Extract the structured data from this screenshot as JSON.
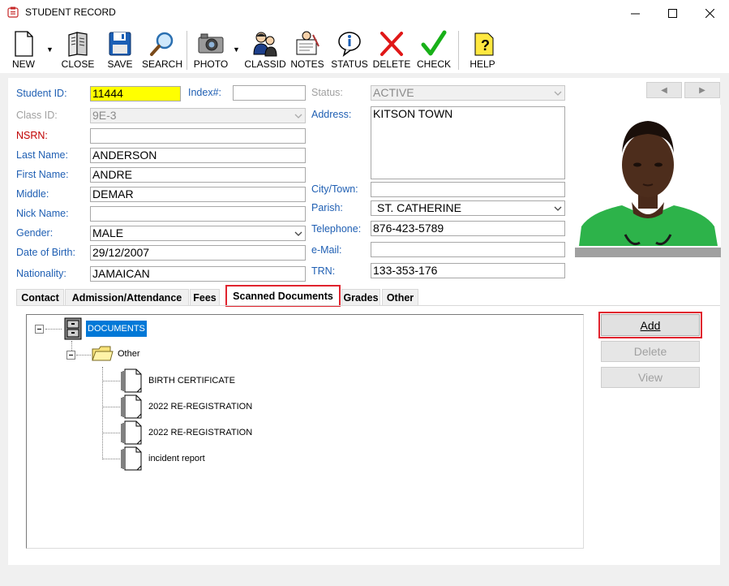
{
  "window": {
    "title": "STUDENT RECORD",
    "minimize": "—",
    "maximize": "☐",
    "close": "✕"
  },
  "toolbar": {
    "new": "NEW",
    "close": "CLOSE",
    "save": "SAVE",
    "search": "SEARCH",
    "photo": "PHOTO",
    "classid": "CLASSID",
    "notes": "NOTES",
    "status": "STATUS",
    "delete": "DELETE",
    "check": "CHECK",
    "help": "HELP"
  },
  "form": {
    "student_id_label": "Student ID:",
    "student_id": "11444",
    "index_label": "Index#:",
    "index_value": "",
    "class_id_label": "Class ID:",
    "class_id": "9E-3",
    "nsrn_label": "NSRN:",
    "nsrn": "",
    "last_name_label": "Last Name:",
    "last_name": "ANDERSON",
    "first_name_label": "First Name:",
    "first_name": "ANDRE",
    "middle_label": "Middle:",
    "middle": "DEMAR",
    "nick_name_label": "Nick Name:",
    "nick_name": "",
    "gender_label": "Gender:",
    "gender": "MALE",
    "dob_label": "Date of Birth:",
    "dob": "29/12/2007",
    "nationality_label": "Nationality:",
    "nationality": "JAMAICAN",
    "status_label": "Status:",
    "status": "ACTIVE",
    "address_label": "Address:",
    "address": "KITSON TOWN",
    "city_label": "City/Town:",
    "city": "",
    "parish_label": "Parish:",
    "parish": "ST. CATHERINE",
    "telephone_label": "Telephone:",
    "telephone": "876-423-5789",
    "email_label": "e-Mail:",
    "email": "",
    "trn_label": "TRN:",
    "trn": "133-353-176"
  },
  "photo_nav": {
    "prev": "◀",
    "next": "▶"
  },
  "tabs": [
    {
      "label": "Contact"
    },
    {
      "label": "Admission/Attendance"
    },
    {
      "label": "Fees"
    },
    {
      "label": "Scanned Documents"
    },
    {
      "label": "Grades"
    },
    {
      "label": "Other"
    }
  ],
  "tree": {
    "root": "DOCUMENTS",
    "folder": "Other",
    "docs": [
      "BIRTH CERTIFICATE",
      "2022 RE-REGISTRATION",
      "2022 RE-REGISTRATION",
      "incident report"
    ]
  },
  "buttons": {
    "add": "Add",
    "delete": "Delete",
    "view": "View"
  },
  "colors": {
    "label_blue": "#1f5fb3",
    "highlight_red": "#e0232e",
    "id_yellow": "#ffff00",
    "selection_blue": "#0078d7"
  },
  "icons": [
    "app-icon",
    "new-doc-icon",
    "close-book-icon",
    "save-disk-icon",
    "search-magnifier-icon",
    "camera-icon",
    "classid-people-icon",
    "notes-icon",
    "status-info-icon",
    "delete-x-icon",
    "check-mark-icon",
    "help-question-icon",
    "cabinet-icon",
    "folder-icon",
    "document-icon"
  ]
}
